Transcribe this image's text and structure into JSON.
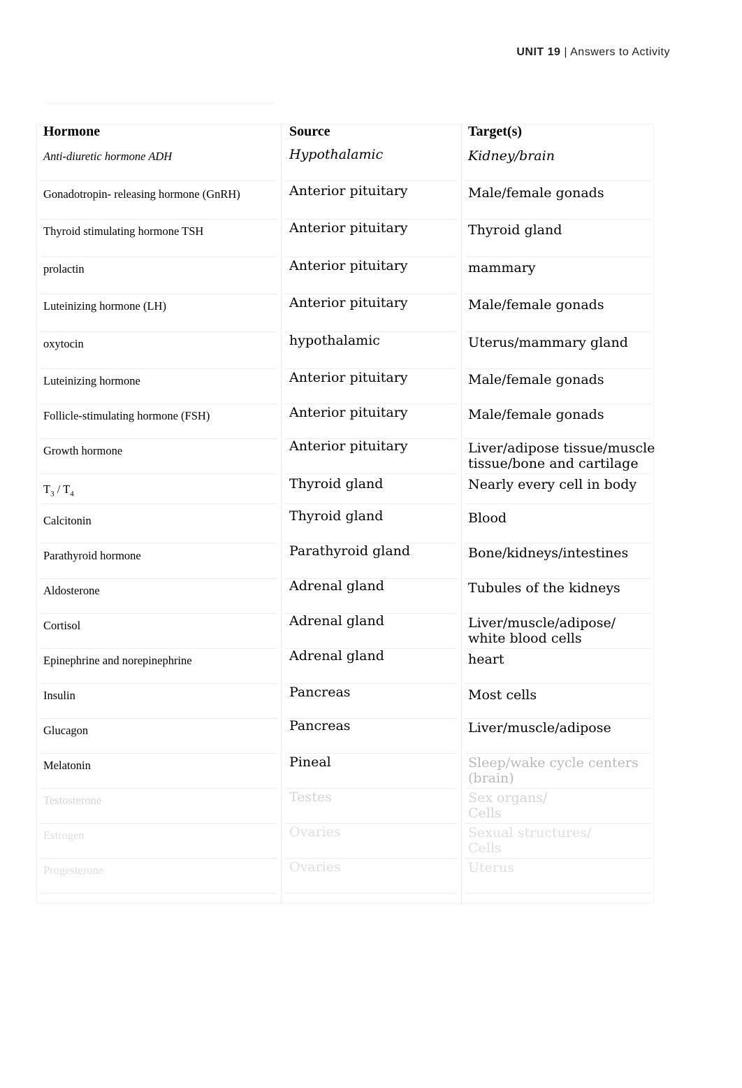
{
  "header": {
    "unit": "UNIT 19",
    "separator": "|",
    "title": "Answers to Activity"
  },
  "faint_rule_text": "________________________________________________________________________________",
  "table": {
    "columns": [
      "Hormone",
      "Source",
      "Target(s)"
    ],
    "rows": [
      {
        "hormone": "Anti-diuretic hormone ADH",
        "source": "Hypothalamic",
        "target": "Kidney/brain",
        "style": "italic",
        "fade": "none"
      },
      {
        "hormone": "Gonadotropin- releasing  hormone  (GnRH)",
        "source": "Anterior pituitary",
        "target": "Male/female gonads",
        "style": "normal",
        "fade": "none"
      },
      {
        "hormone": "Thyroid stimulating hormone TSH",
        "source": "Anterior pituitary",
        "target": "Thyroid gland",
        "style": "normal",
        "fade": "none"
      },
      {
        "hormone": "prolactin",
        "source": "Anterior pituitary",
        "target": "mammary",
        "style": "normal",
        "fade": "none"
      },
      {
        "hormone": "Luteinizing hormone (LH)",
        "source": "Anterior pituitary",
        "target": "Male/female gonads",
        "style": "normal",
        "fade": "none"
      },
      {
        "hormone": "oxytocin",
        "source": "hypothalamic",
        "target": "Uterus/mammary gland",
        "style": "normal",
        "fade": "none"
      },
      {
        "hormone": "Luteinizing  hormone",
        "source": "Anterior pituitary",
        "target": "Male/female gonads",
        "style": "normal",
        "fade": "none"
      },
      {
        "hormone": "Follicle-stimulating hormone (FSH)",
        "source": "Anterior pituitary",
        "target": "Male/female gonads",
        "style": "normal",
        "fade": "none"
      },
      {
        "hormone": "Growth hormone",
        "source": "Anterior pituitary",
        "target": "Liver/adipose tissue/muscle\ntissue/bone and cartilage",
        "style": "normal",
        "fade": "none"
      },
      {
        "hormone": "T3 / T4",
        "source": "Thyroid gland",
        "target": "Nearly every cell in body",
        "style": "normal",
        "fade": "none",
        "subscript": true
      },
      {
        "hormone": "Calcitonin",
        "source": "Thyroid gland",
        "target": "Blood",
        "style": "normal",
        "fade": "none"
      },
      {
        "hormone": "Parathyroid  hormone",
        "source": "Parathyroid gland",
        "target": "Bone/kidneys/intestines",
        "style": "normal",
        "fade": "none"
      },
      {
        "hormone": "Aldosterone",
        "source": "Adrenal gland",
        "target": "Tubules of the kidneys",
        "style": "normal",
        "fade": "none"
      },
      {
        "hormone": "Cortisol",
        "source": "Adrenal gland",
        "target": "Liver/muscle/adipose/\nwhite blood cells",
        "style": "normal",
        "fade": "none"
      },
      {
        "hormone": "Epinephrine  and  norepinephrine",
        "source": "Adrenal gland",
        "target": "heart",
        "style": "normal",
        "fade": "none"
      },
      {
        "hormone": "Insulin",
        "source": "Pancreas",
        "target": "Most cells",
        "style": "normal",
        "fade": "none"
      },
      {
        "hormone": "Glucagon",
        "source": "Pancreas",
        "target": "Liver/muscle/adipose",
        "style": "normal",
        "fade": "none"
      },
      {
        "hormone": "Melatonin",
        "source": "Pineal",
        "target": "Sleep/wake cycle centers\n(brain)",
        "style": "normal",
        "fade": "target-fade1"
      },
      {
        "hormone": "Testosterone",
        "source": "Testes",
        "target": "Sex  organs/\nCells",
        "style": "normal",
        "fade": "fade2"
      },
      {
        "hormone": "Estrogen",
        "source": "Ovaries",
        "target": "Sexual  structures/\nCells",
        "style": "normal",
        "fade": "fade3"
      },
      {
        "hormone": "Progesterone",
        "source": "Ovaries",
        "target": "Uterus",
        "style": "normal",
        "fade": "fade3"
      }
    ]
  }
}
